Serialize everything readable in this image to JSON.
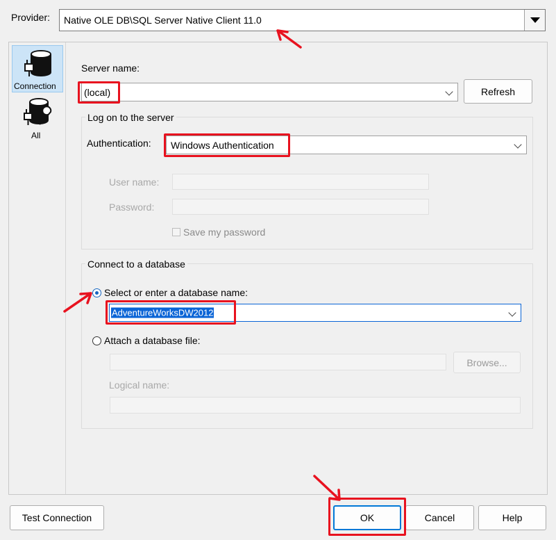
{
  "provider": {
    "label": "Provider:",
    "value": "Native OLE DB\\SQL Server Native Client 11.0"
  },
  "sidebar": {
    "items": [
      {
        "label": "Connection",
        "icon": "database-plug-icon",
        "selected": true
      },
      {
        "label": "All",
        "icon": "database-wrench-icon",
        "selected": false
      }
    ]
  },
  "server": {
    "label": "Server name:",
    "value": "(local)",
    "refresh_label": "Refresh"
  },
  "logon": {
    "group_title": "Log on to the server",
    "auth_label": "Authentication:",
    "auth_value": "Windows Authentication",
    "username_label": "User name:",
    "password_label": "Password:",
    "save_password_label": "Save my password"
  },
  "database": {
    "group_title": "Connect to a database",
    "select_label": "Select or enter a database name:",
    "db_value": "AdventureWorksDW2012",
    "attach_label": "Attach a database file:",
    "browse_label": "Browse...",
    "logical_name_label": "Logical name:"
  },
  "footer": {
    "test_label": "Test Connection",
    "ok_label": "OK",
    "cancel_label": "Cancel",
    "help_label": "Help"
  },
  "colors": {
    "highlight_red": "#e8121f",
    "selection_blue": "#0a64d6",
    "radio_blue": "#1565c0"
  }
}
